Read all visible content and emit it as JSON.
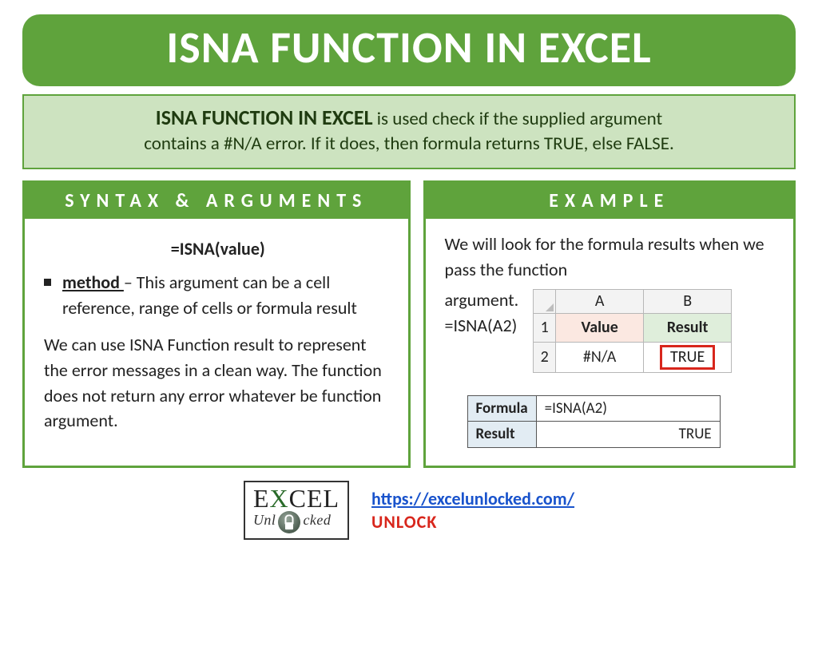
{
  "title": "ISNA FUNCTION IN EXCEL",
  "description": {
    "lead": "ISNA FUNCTION IN EXCEL",
    "rest1": " is used check if the supplied argument",
    "line2": "contains a #N/A error. If it does, then formula returns TRUE, else FALSE."
  },
  "left": {
    "heading": "SYNTAX & ARGUMENTS",
    "syntax": "=ISNA(value)",
    "arg_label": "method ",
    "arg_text": "– This argument can be a cell reference, range of cells or formula result",
    "para": "We can use ISNA Function result to represent the error messages in a clean way. The function does not return any error whatever be function argument."
  },
  "right": {
    "heading": "EXAMPLE",
    "intro": "We will look for the formula results when we pass the function",
    "arg_word": "argument.",
    "formula_inline": "=ISNA(A2)",
    "sheet": {
      "colA": "A",
      "colB": "B",
      "r1": "1",
      "r2": "2",
      "h_value": "Value",
      "h_result": "Result",
      "v2a": "#N/A",
      "v2b": "TRUE"
    },
    "rt": {
      "formula_label": "Formula",
      "formula_value": "=ISNA(A2)",
      "result_label": "Result",
      "result_value": "TRUE"
    }
  },
  "footer": {
    "logo_top1": "E",
    "logo_top2": "X",
    "logo_top3": "CEL",
    "logo_sub": "Unl   cked",
    "url": "https://excelunlocked.com/",
    "unlock": "UNLOCK"
  }
}
